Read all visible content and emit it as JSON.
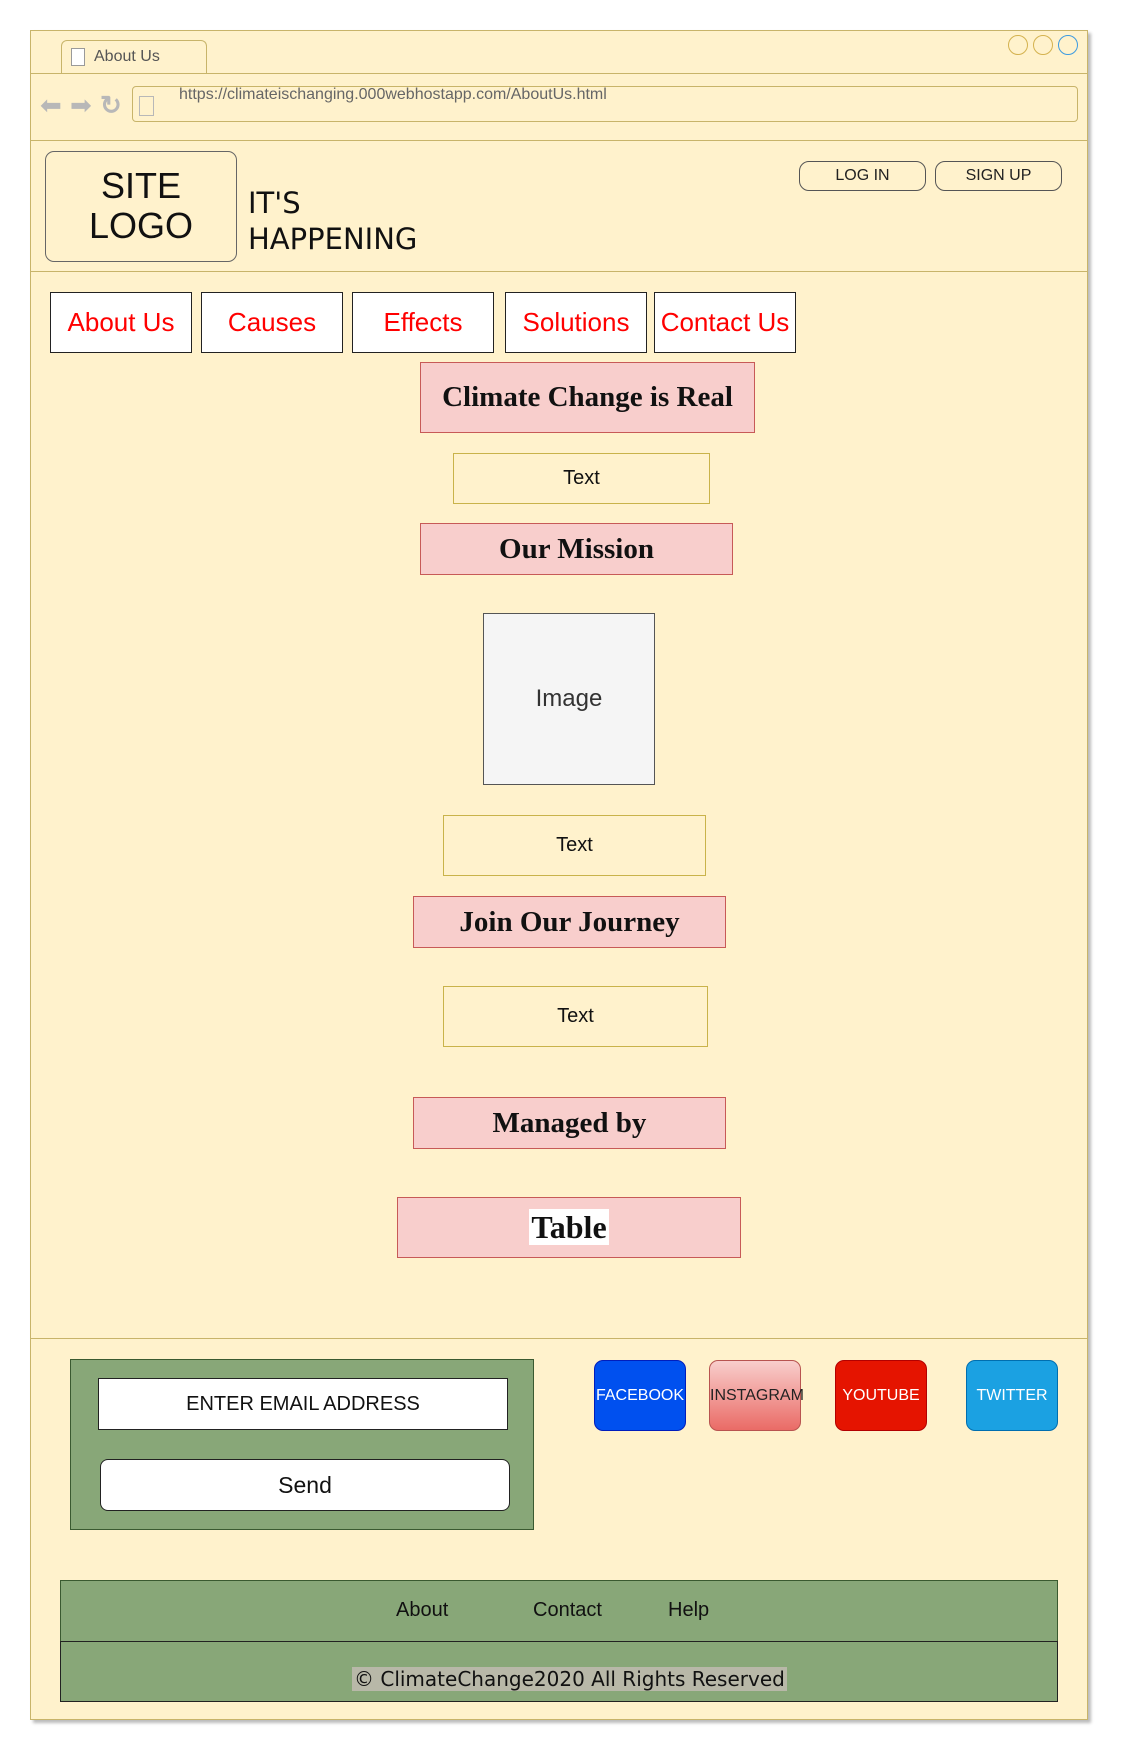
{
  "browser": {
    "tab_title": "About Us",
    "url": "https://climateischanging.000webhostapp.com/AboutUs.html"
  },
  "header": {
    "logo_line1": "SITE",
    "logo_line2": "LOGO",
    "tagline_line1": "IT'S",
    "tagline_line2": "HAPPENING",
    "login_label": "LOG IN",
    "signup_label": "SIGN UP"
  },
  "nav": {
    "items": [
      {
        "label": "About Us"
      },
      {
        "label": "Causes"
      },
      {
        "label": "Effects"
      },
      {
        "label": "Solutions"
      },
      {
        "label": "Contact Us"
      }
    ]
  },
  "main": {
    "heading1": "Climate Change is Real",
    "text1": "Text",
    "heading2": "Our Mission",
    "image_label": "Image",
    "text2": "Text",
    "heading3": "Join Our Journey",
    "text3": "Text",
    "heading4": "Managed by",
    "table_label": "Table"
  },
  "newsletter": {
    "email_placeholder": "ENTER EMAIL ADDRESS",
    "send_label": "Send"
  },
  "social": {
    "facebook": {
      "label": "FACEBOOK",
      "color": "#0050ef"
    },
    "instagram": {
      "label": "INSTAGRAM",
      "color": "#f19c99"
    },
    "youtube": {
      "label": "YOUTUBE",
      "color": "#e51400"
    },
    "twitter": {
      "label": "TWITTER",
      "color": "#1ba1e2"
    }
  },
  "footer": {
    "links": [
      "About",
      "Contact",
      "Help"
    ],
    "copyright": "© ClimateChange2020 All Rights Reserved"
  },
  "colors": {
    "page_bg": "#fff2cc",
    "heading_bg": "#f8cecc",
    "footer_green": "#88a778",
    "nav_text": "#ff0000"
  }
}
